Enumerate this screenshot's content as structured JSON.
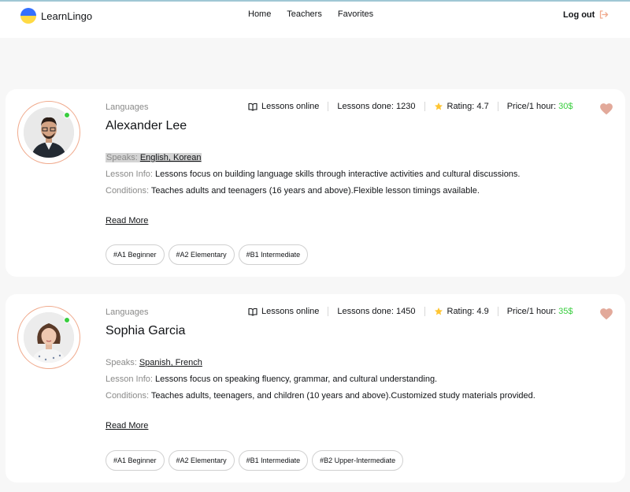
{
  "header": {
    "logo_text": "LearnLingo",
    "nav": [
      "Home",
      "Teachers",
      "Favorites"
    ],
    "logout_label": "Log out"
  },
  "colors": {
    "accent": "#f0aa8d",
    "price_green": "#38cd3e",
    "online_green": "#38cd3e",
    "star": "#ffc531"
  },
  "teachers": [
    {
      "languages_label": "Languages",
      "name": "Alexander Lee",
      "lessons_online": "Lessons online",
      "lessons_done_label": "Lessons done: ",
      "lessons_done": "1230",
      "rating_label": "Rating: ",
      "rating": "4.7",
      "price_label": "Price/1 hour:",
      "price": "30$",
      "speaks_label": "Speaks: ",
      "speaks": "English, Korean",
      "lesson_info_label": "Lesson Info: ",
      "lesson_info": "Lessons focus on building language skills through interactive activities and cultural discussions.",
      "conditions_label": "Conditions: ",
      "conditions": "Teaches adults and teenagers (16 years and above).Flexible lesson timings available.",
      "read_more": "Read More",
      "levels": [
        "#A1 Beginner",
        "#A2 Elementary",
        "#B1 Intermediate"
      ]
    },
    {
      "languages_label": "Languages",
      "name": "Sophia Garcia",
      "lessons_online": "Lessons online",
      "lessons_done_label": "Lessons done: ",
      "lessons_done": "1450",
      "rating_label": "Rating: ",
      "rating": "4.9",
      "price_label": "Price/1 hour:",
      "price": "35$",
      "speaks_label": "Speaks: ",
      "speaks": "Spanish, French",
      "lesson_info_label": "Lesson Info: ",
      "lesson_info": "Lessons focus on speaking fluency, grammar, and cultural understanding.",
      "conditions_label": "Conditions: ",
      "conditions": "Teaches adults, teenagers, and children (10 years and above).Customized study materials provided.",
      "read_more": "Read More",
      "levels": [
        "#A1 Beginner",
        "#A2 Elementary",
        "#B1 Intermediate",
        "#B2 Upper-Intermediate"
      ]
    }
  ]
}
